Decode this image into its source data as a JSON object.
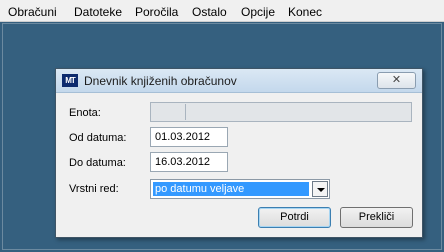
{
  "menu": {
    "items": [
      "Obračuni",
      "Datoteke",
      "Poročila",
      "Ostalo",
      "Opcije",
      "Konec"
    ]
  },
  "dialog": {
    "icon_text": "MT",
    "title": "Dnevnik knjiženih obračunov",
    "close_symbol": "✕",
    "fields": {
      "enota_label": "Enota:",
      "od_label": "Od datuma:",
      "od_value": "01.03.2012",
      "do_label": "Do datuma:",
      "do_value": "16.03.2012",
      "vrstni_label": "Vrstni red:",
      "vrstni_value": "po datumu veljave"
    },
    "buttons": {
      "ok": "Potrdi",
      "cancel": "Prekliči"
    }
  }
}
